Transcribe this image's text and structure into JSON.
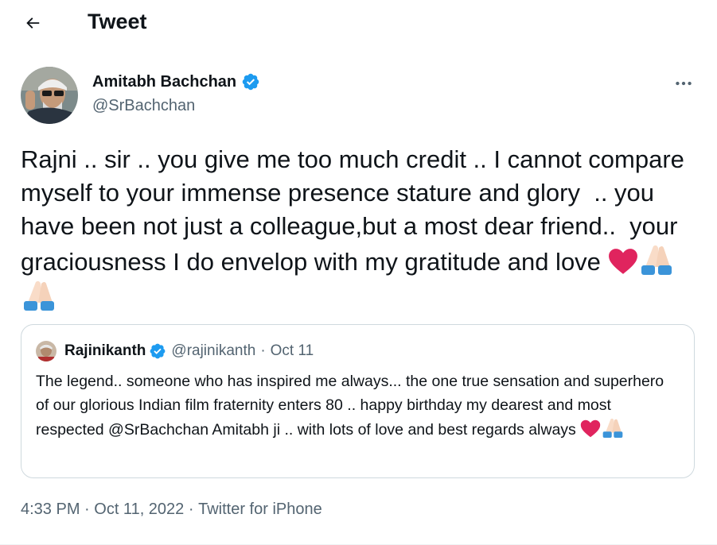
{
  "header": {
    "title": "Tweet",
    "back_icon": "arrow-left-icon"
  },
  "tweet": {
    "author": {
      "name": "Amitabh Bachchan",
      "handle": "@SrBachchan",
      "verified": true
    },
    "text": "Rajni .. sir .. you give me too much credit .. I cannot compare myself to your immense presence stature and glory  .. you have been not just a colleague,but a most dear friend..  your graciousness I do envelop with my gratitude and love ",
    "emojis": [
      "heart-icon",
      "folded-hands-icon",
      "folded-hands-icon"
    ],
    "more_icon": "more-dots-icon"
  },
  "quote": {
    "author": {
      "name": "Rajinikanth",
      "handle": "@rajinikanth",
      "verified": true
    },
    "separator": "·",
    "date": "Oct 11",
    "text": "The legend.. someone who has inspired me always... the one true sensation and superhero of our glorious Indian film fraternity enters 80 .. happy birthday my dearest and most respected @SrBachchan Amitabh ji .. with lots of love and best regards always ",
    "emojis": [
      "heart-icon",
      "folded-hands-icon"
    ]
  },
  "meta": {
    "time": "4:33 PM",
    "separator": " · ",
    "date": "Oct 11, 2022",
    "source": "Twitter for iPhone"
  },
  "colors": {
    "text": "#0f1419",
    "secondary": "#536471",
    "verified": "#1d9bf0",
    "border": "#cfd9de",
    "heart": "#e0245e"
  }
}
